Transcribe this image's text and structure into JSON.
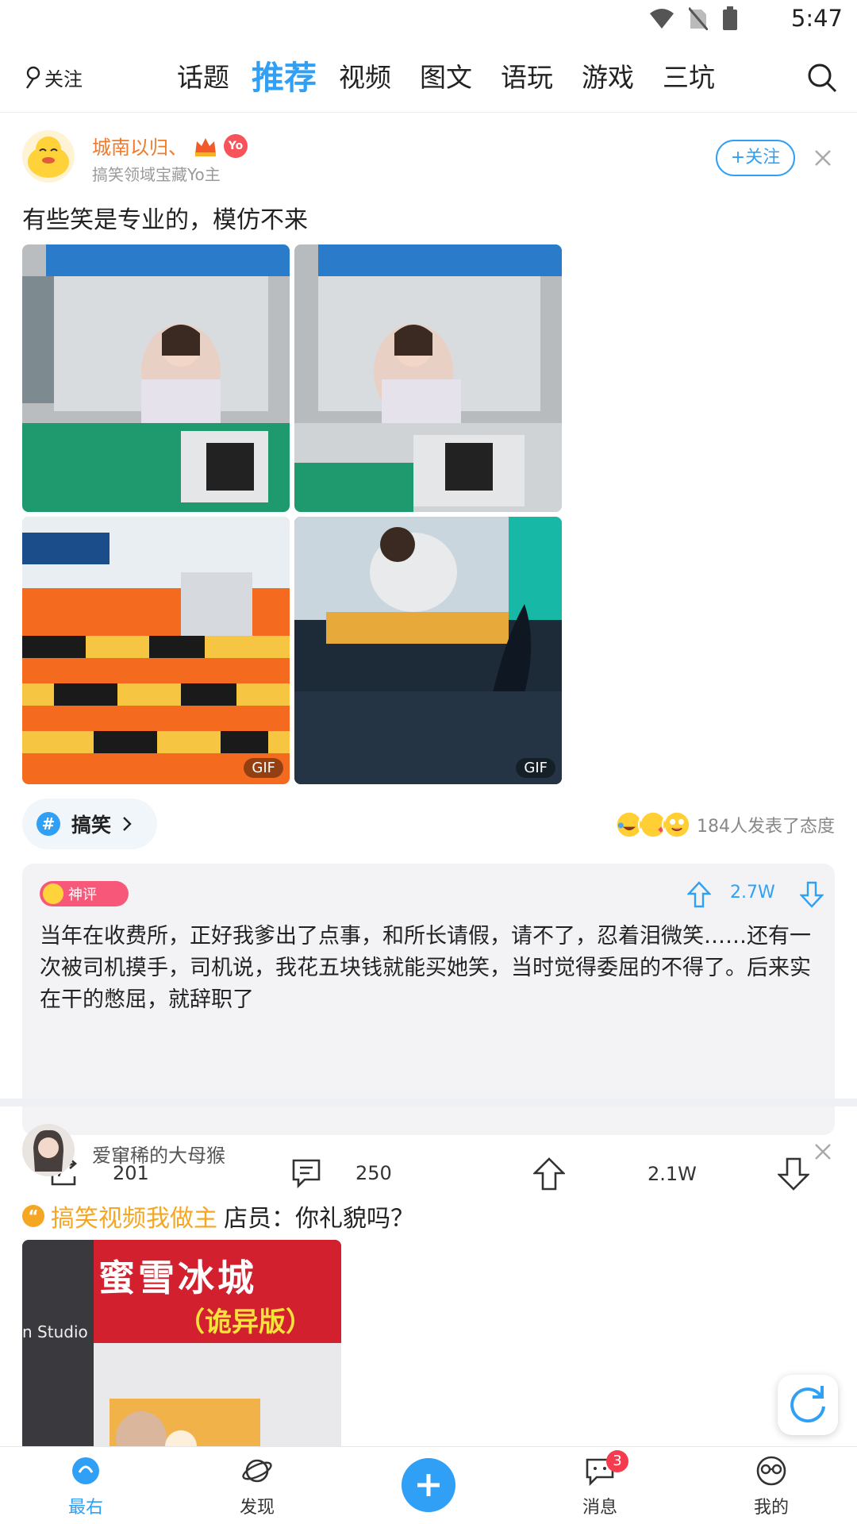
{
  "status_bar": {
    "time": "5:47"
  },
  "top_nav": {
    "follow_label": "关注",
    "tabs": [
      "话题",
      "推荐",
      "视频",
      "图文",
      "语玩",
      "游戏",
      "三坑"
    ],
    "active_tab": "推荐"
  },
  "post1": {
    "author": "城南以归、",
    "author_subtitle": "搞笑领域宝藏Yo主",
    "yo_badge": "Yo",
    "follow_label": "+关注",
    "title": "有些笑是专业的，模仿不来",
    "gif_label": "GIF",
    "topic": "搞笑",
    "reactions_text": "184人发表了态度",
    "god_comment": {
      "badge": "神评",
      "likes": "2.7W",
      "text": "当年在收费所，正好我爹出了点事，和所长请假，请不了，忍着泪微笑……还有一次被司机摸手，司机说，我花五块钱就能买她笑，当时觉得委屈的不得了。后来实在干的憋屈，就辞职了"
    },
    "actions": {
      "shares": "201",
      "comments": "250",
      "likes": "2.1W"
    }
  },
  "post2": {
    "author": "爱窜稀的大母猴",
    "topic_link": "搞笑视频我做主",
    "title": "店员：你礼貌吗？",
    "video_sign_line1": "蜜雪冰城",
    "video_sign_line2": "（诡异版）",
    "video_wall_text": "n Studio"
  },
  "bottom_nav": {
    "items": [
      "最右",
      "发现",
      "消息",
      "我的"
    ],
    "active": "最右",
    "message_badge": "3"
  },
  "colors": {
    "accent": "#2fa0f5",
    "author_orange": "#f07a2a",
    "god_pink": "#f7587a",
    "topic_orange": "#f5a623"
  }
}
